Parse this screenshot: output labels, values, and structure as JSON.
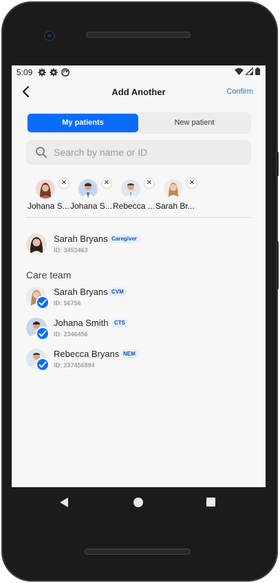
{
  "status_bar": {
    "time": "5:09",
    "left_icons": [
      "gear-icon",
      "gear-icon",
      "sync-icon"
    ],
    "right_icons": [
      "wifi-icon",
      "signal-icon",
      "battery-icon"
    ]
  },
  "header": {
    "title": "Add Another",
    "confirm_label": "Confirm",
    "back_icon": "chevron-left-icon"
  },
  "tabs": {
    "my_patients": "My patients",
    "new_patient": "New patient",
    "active": "my_patients"
  },
  "search": {
    "placeholder": "Search by name or ID",
    "value": ""
  },
  "selected": [
    {
      "name": "Johana S...",
      "remove_icon": "close-icon"
    },
    {
      "name": "Johana S...",
      "remove_icon": "close-icon"
    },
    {
      "name": "Rebecca ...",
      "remove_icon": "close-icon"
    },
    {
      "name": "Sarah Br...",
      "remove_icon": "close-icon"
    }
  ],
  "primary_contact": {
    "name": "Sarah Bryans",
    "badge": "Caregiver",
    "id": "ID: 3453463"
  },
  "care_team": {
    "heading": "Care team",
    "members": [
      {
        "name": "Sarah Bryans",
        "badge": "CVM",
        "id": "ID: 56756",
        "selected": true
      },
      {
        "name": "Johana Smith",
        "badge": "CTS",
        "id": "ID: 2346456",
        "selected": true
      },
      {
        "name": "Rebecca Bryans",
        "badge": "NEM",
        "id": "ID: 237456894",
        "selected": true
      }
    ]
  },
  "colors": {
    "accent": "#0a6cff",
    "badge_bg": "#e6f0ff",
    "screen_bg": "#f7f7f7"
  }
}
